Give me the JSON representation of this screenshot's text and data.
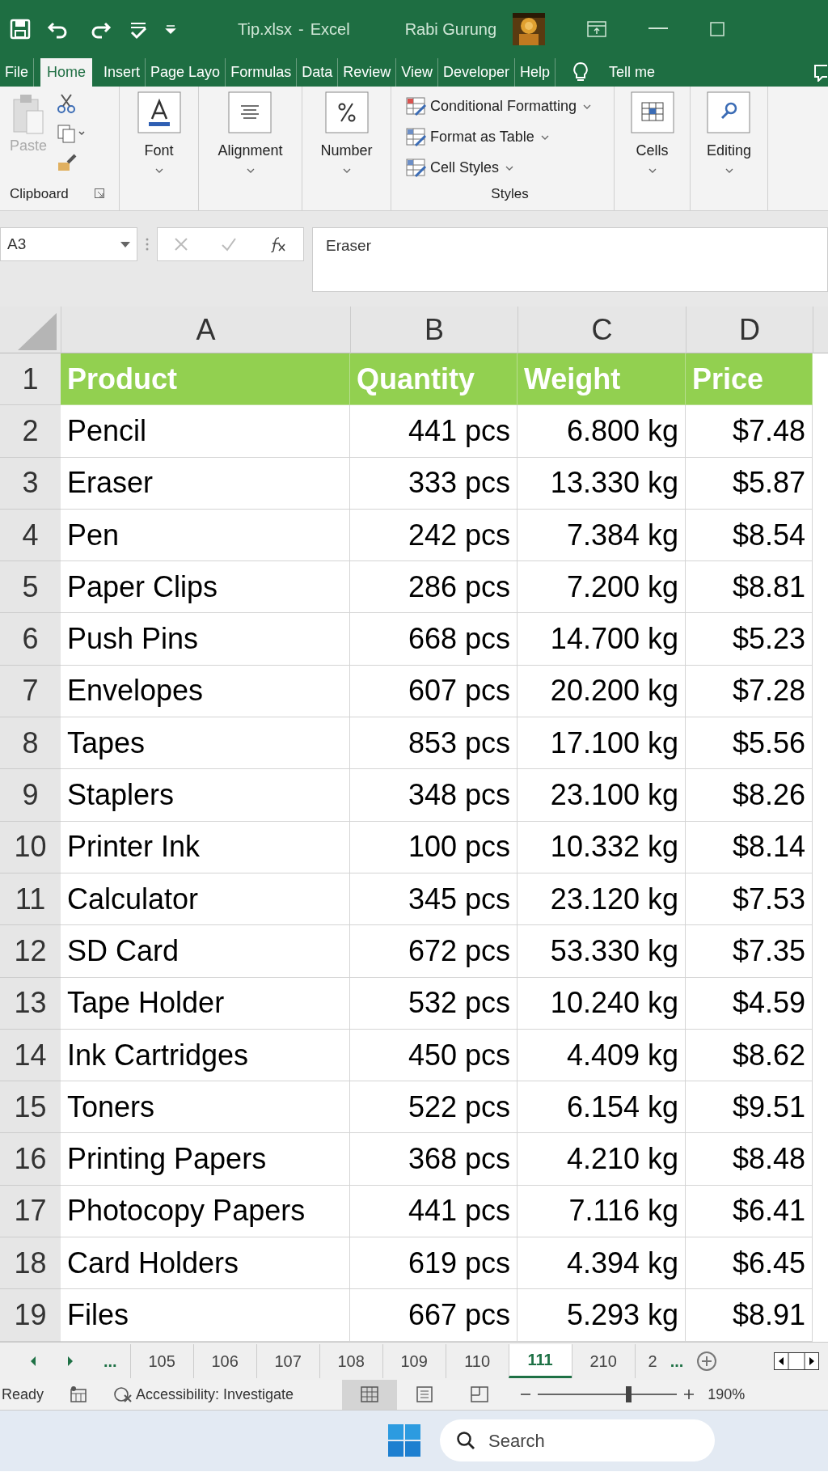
{
  "window": {
    "file": "Tip.xlsx",
    "separator": "-",
    "app": "Excel",
    "user": "Rabi Gurung"
  },
  "ribbon_tabs": [
    {
      "label": "File",
      "selected": false
    },
    {
      "label": "Home",
      "selected": true
    },
    {
      "label": "Insert",
      "selected": false
    },
    {
      "label": "Page Layo",
      "selected": false
    },
    {
      "label": "Formulas",
      "selected": false
    },
    {
      "label": "Data",
      "selected": false
    },
    {
      "label": "Review",
      "selected": false
    },
    {
      "label": "View",
      "selected": false
    },
    {
      "label": "Developer",
      "selected": false
    },
    {
      "label": "Help",
      "selected": false
    }
  ],
  "tell_me": "Tell me",
  "clipboard": {
    "paste": "Paste",
    "paste_disabled": true,
    "group": "Clipboard"
  },
  "big_buttons": [
    {
      "label": "Font",
      "kind": "font"
    },
    {
      "label": "Alignment",
      "kind": "align"
    },
    {
      "label": "Number",
      "kind": "number"
    }
  ],
  "styles": {
    "items": [
      "Conditional Formatting",
      "Format as Table",
      "Cell Styles"
    ],
    "group": "Styles"
  },
  "big_buttons_right": [
    {
      "label": "Cells",
      "kind": "cells"
    },
    {
      "label": "Editing",
      "kind": "editing"
    }
  ],
  "formula_bar": {
    "name_box": "A3",
    "value": "Eraser"
  },
  "columns": [
    "A",
    "B",
    "C",
    "D"
  ],
  "header_row": {
    "number": "1",
    "cells": [
      "Product",
      "Quantity",
      "Weight",
      "Price"
    ]
  },
  "rows": [
    {
      "number": "2",
      "cells": [
        "Pencil",
        "441 pcs",
        "6.800 kg",
        "$7.48"
      ]
    },
    {
      "number": "3",
      "cells": [
        "Eraser",
        "333 pcs",
        "13.330 kg",
        "$5.87"
      ]
    },
    {
      "number": "4",
      "cells": [
        "Pen",
        "242 pcs",
        "7.384 kg",
        "$8.54"
      ]
    },
    {
      "number": "5",
      "cells": [
        "Paper Clips",
        "286 pcs",
        "7.200 kg",
        "$8.81"
      ]
    },
    {
      "number": "6",
      "cells": [
        "Push Pins",
        "668 pcs",
        "14.700 kg",
        "$5.23"
      ]
    },
    {
      "number": "7",
      "cells": [
        "Envelopes",
        "607 pcs",
        "20.200 kg",
        "$7.28"
      ]
    },
    {
      "number": "8",
      "cells": [
        "Tapes",
        "853 pcs",
        "17.100 kg",
        "$5.56"
      ]
    },
    {
      "number": "9",
      "cells": [
        "Staplers",
        "348 pcs",
        "23.100 kg",
        "$8.26"
      ]
    },
    {
      "number": "10",
      "cells": [
        "Printer Ink",
        "100 pcs",
        "10.332 kg",
        "$8.14"
      ]
    },
    {
      "number": "11",
      "cells": [
        "Calculator",
        "345 pcs",
        "23.120 kg",
        "$7.53"
      ]
    },
    {
      "number": "12",
      "cells": [
        "SD Card",
        "672 pcs",
        "53.330 kg",
        "$7.35"
      ]
    },
    {
      "number": "13",
      "cells": [
        "Tape Holder",
        "532 pcs",
        "10.240 kg",
        "$4.59"
      ]
    },
    {
      "number": "14",
      "cells": [
        "Ink Cartridges",
        "450 pcs",
        "4.409 kg",
        "$8.62"
      ]
    },
    {
      "number": "15",
      "cells": [
        "Toners",
        "522 pcs",
        "6.154 kg",
        "$9.51"
      ]
    },
    {
      "number": "16",
      "cells": [
        "Printing Papers",
        "368 pcs",
        "4.210 kg",
        "$8.48"
      ]
    },
    {
      "number": "17",
      "cells": [
        "Photocopy Papers",
        "441 pcs",
        "7.116 kg",
        "$6.41"
      ]
    },
    {
      "number": "18",
      "cells": [
        "Card Holders",
        "619 pcs",
        "4.394 kg",
        "$6.45"
      ]
    },
    {
      "number": "19",
      "cells": [
        "Files",
        "667 pcs",
        "5.293 kg",
        "$8.91"
      ]
    }
  ],
  "sheet_tabs": {
    "more_left": "...",
    "tabs": [
      {
        "label": "105",
        "selected": false
      },
      {
        "label": "106",
        "selected": false
      },
      {
        "label": "107",
        "selected": false
      },
      {
        "label": "108",
        "selected": false
      },
      {
        "label": "109",
        "selected": false
      },
      {
        "label": "110",
        "selected": false
      },
      {
        "label": "111",
        "selected": true
      },
      {
        "label": "210",
        "selected": false
      },
      {
        "label": "2",
        "selected": false
      }
    ],
    "more_right": "..."
  },
  "status_bar": {
    "state": "Ready",
    "accessibility": "Accessibility: Investigate",
    "views": [
      {
        "kind": "normal",
        "selected": true
      },
      {
        "kind": "layout",
        "selected": false
      },
      {
        "kind": "break",
        "selected": false
      }
    ],
    "zoom": {
      "level": 0.65
    },
    "zoom_text": "190%"
  },
  "taskbar": {
    "search": "Search"
  }
}
